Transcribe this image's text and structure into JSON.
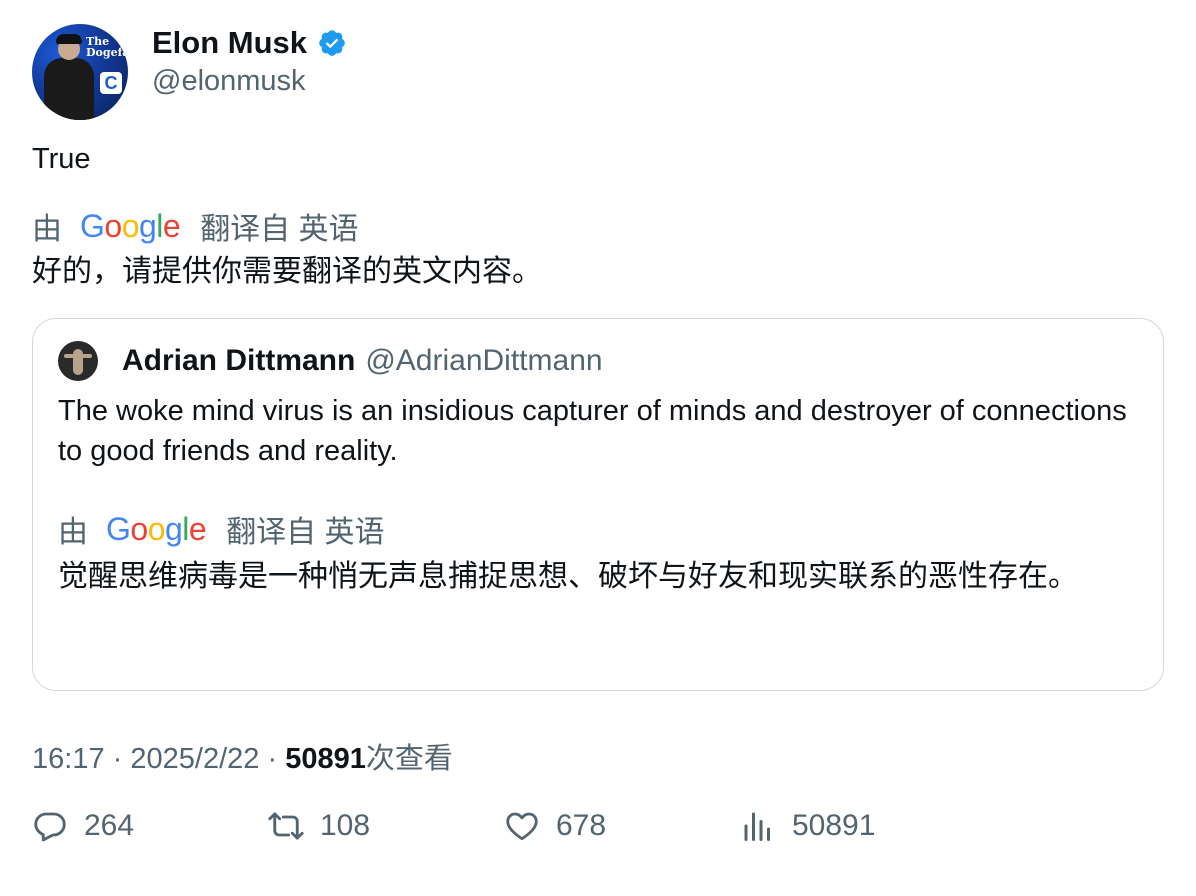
{
  "author": {
    "name": "Elon Musk",
    "handle": "@elonmusk",
    "avatar_icon": "avatar-photo",
    "verified_icon": "verified-badge-icon",
    "avatar_text": "The Dogefa",
    "avatar_logo": "C"
  },
  "tweet": {
    "text": "True",
    "translate": {
      "by": "由",
      "provider": "Google",
      "from": "翻译自 英语"
    },
    "translation": "好的，请提供你需要翻译的英文内容。"
  },
  "quote": {
    "name": "Adrian Dittmann",
    "handle": "@AdrianDittmann",
    "text": "The woke mind virus is an insidious capturer of minds and destroyer of connections to good friends and reality.",
    "translate": {
      "by": "由",
      "provider": "Google",
      "from": "翻译自 英语"
    },
    "translation": "觉醒思维病毒是一种悄无声息捕捉思想、破坏与好友和现实联系的恶性存在。"
  },
  "meta": {
    "time": "16:17",
    "separator": "·",
    "date": "2025/2/22",
    "views_count": "50891",
    "views_label": "次查看"
  },
  "actions": {
    "replies": "264",
    "retweets": "108",
    "likes": "678",
    "views": "50891"
  },
  "colors": {
    "verified": "#1d9bf0",
    "secondary_text": "#536471",
    "border": "#cfd9de"
  }
}
